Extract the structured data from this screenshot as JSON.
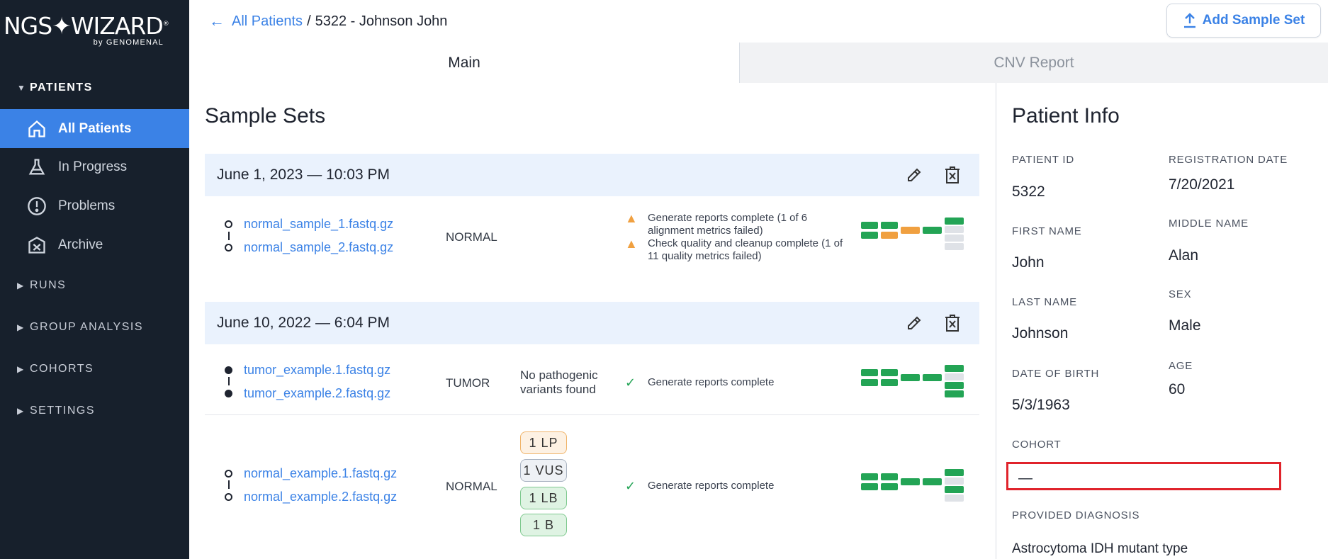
{
  "app": {
    "logo_text": "NGS✦WIZARD",
    "logo_reg": "®",
    "logo_by": "by GENOMENAL"
  },
  "sidebar": {
    "patients_label": "PATIENTS",
    "items": [
      {
        "label": "All Patients",
        "icon": "home-icon",
        "active": true
      },
      {
        "label": "In Progress",
        "icon": "flask-icon",
        "active": false
      },
      {
        "label": "Problems",
        "icon": "alert-circle-icon",
        "active": false
      },
      {
        "label": "Archive",
        "icon": "archive-icon",
        "active": false
      }
    ],
    "sections": [
      "RUNS",
      "GROUP ANALYSIS",
      "COHORTS",
      "SETTINGS"
    ]
  },
  "breadcrumb": {
    "back_icon": "arrow-left-icon",
    "link": "All Patients",
    "separator": "/",
    "current": "5322 - Johnson John"
  },
  "add_sample_set": {
    "label": "Add Sample Set",
    "icon": "upload-icon"
  },
  "tabs": [
    {
      "label": "Main",
      "active": true
    },
    {
      "label": "CNV Report",
      "active": false
    }
  ],
  "sample_sets": {
    "title": "Sample Sets",
    "sets": [
      {
        "date": "June 1, 2023 — 10:03 PM",
        "samples": [
          {
            "files": [
              "normal_sample_1.fastq.gz",
              "normal_sample_2.fastq.gz"
            ],
            "type": "NORMAL",
            "statuses": [
              {
                "icon": "warning-icon",
                "text": "Generate reports complete (1 of 6 alignment metrics failed)"
              },
              {
                "icon": "warning-icon",
                "text": "Check quality and cleanup complete (1 of 11 quality metrics failed)"
              }
            ]
          }
        ]
      },
      {
        "date": "June 10, 2022 — 6:04 PM",
        "samples": [
          {
            "files": [
              "tumor_example.1.fastq.gz",
              "tumor_example.2.fastq.gz"
            ],
            "type": "TUMOR",
            "variants_text": "No pathogenic variants found",
            "statuses": [
              {
                "icon": "check-icon",
                "text": "Generate reports complete"
              }
            ]
          },
          {
            "files": [
              "normal_example.1.fastq.gz",
              "normal_example.2.fastq.gz"
            ],
            "type": "NORMAL",
            "badges": [
              "1  LP",
              "1  VUS",
              "1  LB",
              "1  B"
            ],
            "statuses": [
              {
                "icon": "check-icon",
                "text": "Generate reports complete"
              }
            ]
          }
        ]
      }
    ]
  },
  "patient_info": {
    "title": "Patient Info",
    "patient_id_label": "PATIENT ID",
    "patient_id": "5322",
    "registration_date_label": "REGISTRATION DATE",
    "registration_date": "7/20/2021",
    "first_name_label": "FIRST NAME",
    "first_name": "John",
    "middle_name_label": "MIDDLE NAME",
    "middle_name": "Alan",
    "last_name_label": "LAST NAME",
    "last_name": "Johnson",
    "sex_label": "SEX",
    "sex": "Male",
    "dob_label": "DATE OF BIRTH",
    "dob": "5/3/1963",
    "age_label": "AGE",
    "age": "60",
    "cohort_label": "COHORT",
    "cohort": "—",
    "diagnosis_label": "PROVIDED DIAGNOSIS",
    "diagnosis": "Astrocytoma IDH mutant type"
  },
  "colors": {
    "accent": "#3b82e6",
    "sidebar_bg": "#17202c",
    "qc_pass": "#23a455",
    "qc_warn": "#f0a040",
    "qc_empty": "#dfe2e7",
    "highlight_box": "#e0232b"
  }
}
